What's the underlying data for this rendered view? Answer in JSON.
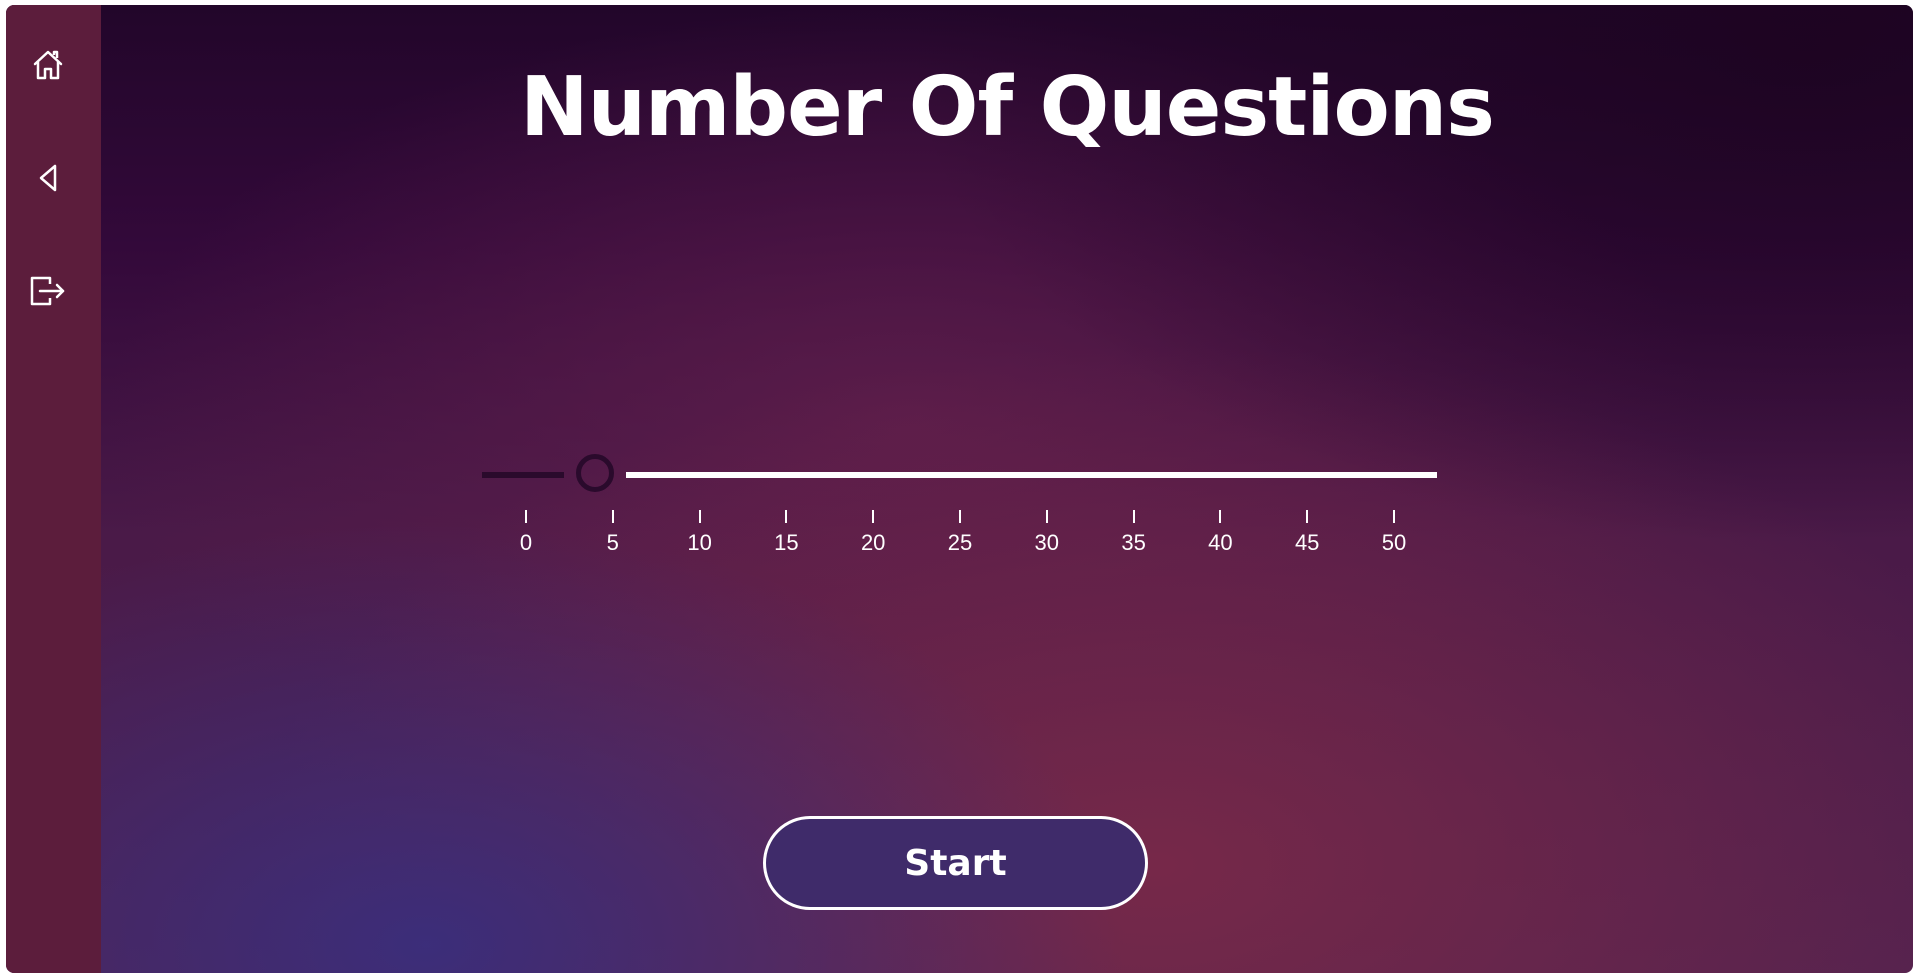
{
  "title": "Number Of Questions",
  "sidebar": {
    "items": [
      {
        "icon": "home-icon"
      },
      {
        "icon": "back-arrow-icon"
      },
      {
        "icon": "logout-icon"
      }
    ]
  },
  "slider": {
    "min": 0,
    "max": 50,
    "value": 4,
    "tick_labels": [
      "0",
      "5",
      "10",
      "15",
      "20",
      "25",
      "30",
      "35",
      "40",
      "45",
      "50"
    ]
  },
  "start_button": {
    "label": "Start"
  },
  "colors": {
    "sidebar": "#5c1d3c",
    "track_filled": "#2a0a2c",
    "track_rest": "#ffffff",
    "button_fill": "#3f2b6a"
  }
}
